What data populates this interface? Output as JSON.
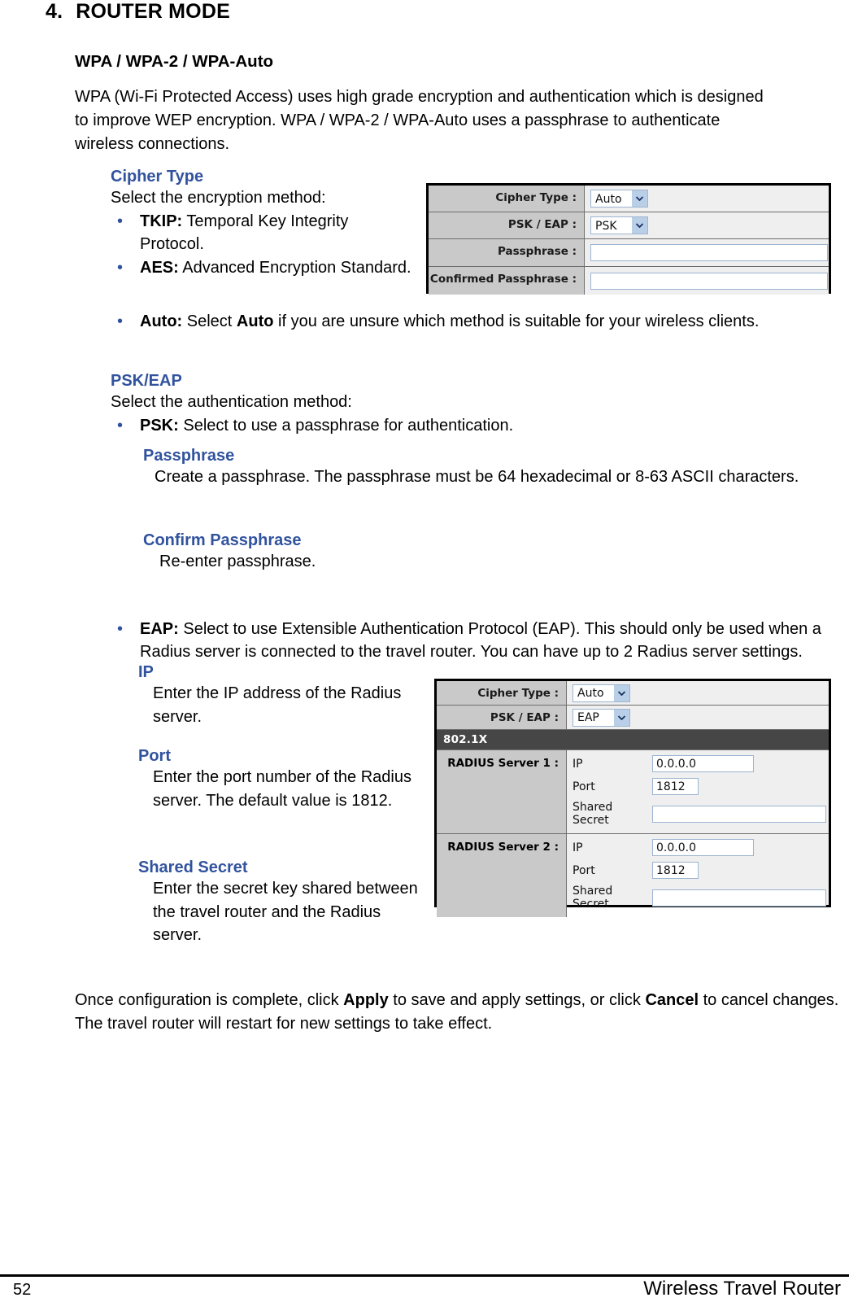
{
  "document": {
    "chapter_number": "4.",
    "chapter_title": "ROUTER MODE",
    "section_heading": "WPA / WPA-2 / WPA-Auto",
    "intro_paragraph": "WPA (Wi-Fi Protected Access) uses high grade encryption and authentication which is designed to improve WEP encryption. WPA / WPA-2 / WPA-Auto uses a passphrase to authenticate wireless connections.",
    "closing_paragraph_part1": "Once configuration is complete, click ",
    "closing_apply": "Apply",
    "closing_paragraph_part2": " to save and apply settings, or click ",
    "closing_cancel": "Cancel",
    "closing_paragraph_part3": " to cancel changes. The travel router will restart for new settings to take effect."
  },
  "footer": {
    "page_number": "52",
    "product_name": "Wireless Travel Router"
  },
  "cipher_type": {
    "heading": "Cipher Type",
    "lead_in": "Select the encryption method:",
    "bullets": [
      {
        "term": "TKIP:",
        "desc": " Temporal Key Integrity Protocol."
      },
      {
        "term": "AES:",
        "desc": " Advanced Encryption Standard."
      },
      {
        "term": "Auto:",
        "desc_before": " Select ",
        "desc_bold": "Auto",
        "desc_after": " if you are unsure which method is suitable for your wireless clients."
      }
    ]
  },
  "psk_eap": {
    "heading": "PSK/EAP",
    "lead_in": "Select the authentication method:",
    "psk_term": "PSK:",
    "psk_desc": " Select to use a passphrase for authentication.",
    "passphrase_heading": "Passphrase",
    "passphrase_desc": "Create a passphrase. The passphrase must be 64 hexadecimal or 8-63 ASCII characters.",
    "confirm_heading": "Confirm Passphrase",
    "confirm_desc": "Re-enter passphrase.",
    "eap_term": "EAP:",
    "eap_desc": " Select to use Extensible Authentication Protocol (EAP). This should only be used when a Radius server is connected to the travel router. You can have up to 2 Radius server settings.",
    "ip_heading": "IP",
    "ip_desc": "Enter the IP address of the Radius server.",
    "port_heading": "Port",
    "port_desc": "Enter the port number of the Radius server. The default value is 1812.",
    "shared_secret_heading": "Shared Secret",
    "shared_secret_desc": "Enter the secret key shared between the travel router and the Radius server."
  },
  "screenshot_psk": {
    "rows": [
      {
        "label": "Cipher Type :",
        "control": "select",
        "value": "Auto"
      },
      {
        "label": "PSK / EAP :",
        "control": "select",
        "value": "PSK"
      },
      {
        "label": "Passphrase :",
        "control": "input",
        "value": ""
      },
      {
        "label": "Confirmed Passphrase :",
        "control": "input",
        "value": ""
      }
    ]
  },
  "screenshot_eap": {
    "rows": [
      {
        "label": "Cipher Type :",
        "control": "select",
        "value": "Auto"
      },
      {
        "label": "PSK / EAP :",
        "control": "select",
        "value": "EAP"
      }
    ],
    "section_bar": "802.1X",
    "radius_servers": [
      {
        "label": "RADIUS Server 1 :",
        "fields": [
          {
            "name": "IP",
            "value": "0.0.0.0"
          },
          {
            "name": "Port",
            "value": "1812"
          },
          {
            "name": "Shared Secret",
            "value": ""
          }
        ]
      },
      {
        "label": "RADIUS Server 2 :",
        "fields": [
          {
            "name": "IP",
            "value": "0.0.0.0"
          },
          {
            "name": "Port",
            "value": "1812"
          },
          {
            "name": "Shared Secret",
            "value": ""
          }
        ]
      }
    ]
  },
  "colors": {
    "heading_blue": "#31539E",
    "panel_label_gray": "#c9c9c9",
    "panel_body_gray": "#efefef",
    "bar_dark": "#464646",
    "input_border": "#9cb4d0"
  }
}
